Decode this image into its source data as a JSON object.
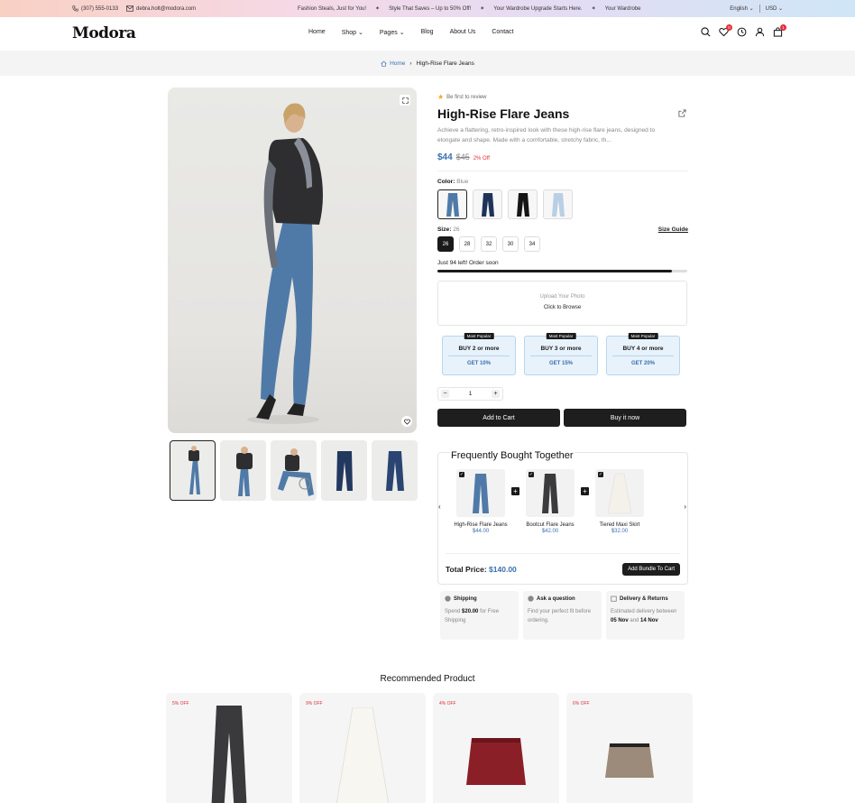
{
  "topbar": {
    "phone": "(307) 555-0133",
    "email": "debra.holt@modora.com",
    "messages": [
      "Fashion Steals, Just for You!",
      "Style That Saves – Up to 50% Off!",
      "Your Wardrobe Upgrade Starts Here.",
      "Your Wardrobe"
    ],
    "language": "English",
    "currency": "USD"
  },
  "header": {
    "logo": "Modora",
    "nav": [
      {
        "label": "Home",
        "dropdown": false
      },
      {
        "label": "Shop",
        "dropdown": true
      },
      {
        "label": "Pages",
        "dropdown": true
      },
      {
        "label": "Blog",
        "dropdown": false
      },
      {
        "label": "About Us",
        "dropdown": false
      },
      {
        "label": "Contact",
        "dropdown": false
      }
    ],
    "wishlist_count": "0",
    "cart_count": "1"
  },
  "breadcrumb": {
    "home": "Home",
    "current": "High-Rise Flare Jeans"
  },
  "product": {
    "review": "Be first to review",
    "title": "High-Rise Flare Jeans",
    "description": "Achieve a flattering, retro-inspired look with these high-rise flare jeans, designed to elongate and shape. Made with a comfortable, stretchy fabric, th...",
    "price": "$44",
    "old_price": "$45",
    "discount": "2% Off",
    "color_label": "Color:",
    "color_value": "Blue",
    "size_label": "Size:",
    "size_value": "26",
    "size_guide": "Size Guide",
    "sizes": [
      "26",
      "28",
      "32",
      "30",
      "34"
    ],
    "stock_text": "Just 94 left! Order soon",
    "stock_fraction": 0.94,
    "upload_hint": "Upload Your Photo",
    "upload_action": "Click to Browse",
    "bundles": [
      {
        "tag": "Most Popular",
        "title": "BUY 2 or more",
        "offer": "GET 10%"
      },
      {
        "tag": "Most Popular",
        "title": "BUY 3 or more",
        "offer": "GET 15%"
      },
      {
        "tag": "Most Popular",
        "title": "BUY 4 or more",
        "offer": "GET 20%"
      }
    ],
    "quantity": "1",
    "add_to_cart": "Add to Cart",
    "buy_now": "Buy it now"
  },
  "fbt": {
    "title": "Frequently Bought Together",
    "items": [
      {
        "name": "High-Rise Flare Jeans",
        "price": "$44.00"
      },
      {
        "name": "Bootcut Flare Jeans",
        "price": "$42.00"
      },
      {
        "name": "Tiered Maxi Skirt",
        "price": "$32.00"
      }
    ],
    "total_label": "Total Price:",
    "total_value": "$140.00",
    "add_bundle": "Add Bundle To Cart"
  },
  "features": {
    "shipping": {
      "title": "Shipping",
      "pre": "Spend",
      "amount": "$20.00",
      "post": "for Free Shipping"
    },
    "ask": {
      "title": "Ask a question",
      "body": "Find your perfect fit before ordering."
    },
    "delivery": {
      "title": "Delivery & Returns",
      "pre": "Estimated delivery between",
      "d1": "05 Nov",
      "mid": "and",
      "d2": "14 Nov"
    }
  },
  "recommended": {
    "title": "Recommended Product",
    "items": [
      {
        "badge": "5% OFF"
      },
      {
        "badge": "9% OFF"
      },
      {
        "badge": "4% OFF"
      },
      {
        "badge": "6% OFF"
      }
    ]
  },
  "colors": {
    "accent": "#3a6fb0",
    "sale": "#e0303a",
    "dark": "#1e1e1e"
  }
}
